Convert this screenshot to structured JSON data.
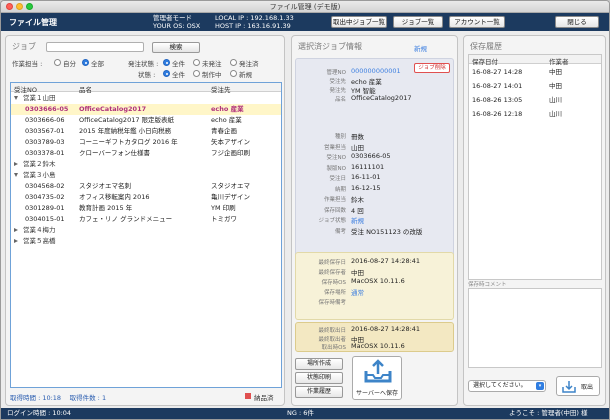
{
  "window": {
    "title": "ファイル管理 (デモ版)"
  },
  "header": {
    "app_title": "ファイル管理",
    "mode_label": "管理者モード",
    "os_label": "YOUR OS: OSX",
    "local_ip": "LOCAL IP : 192.168.1.33",
    "host_ip": "HOST IP : 163.16.91.39",
    "btn_taking": "取出中ジョブ一覧",
    "btn_jobs": "ジョブ一覧",
    "btn_accounts": "アカウント一覧",
    "btn_close": "閉じる"
  },
  "search": {
    "section_title": "ジョブ",
    "search_button": "検索",
    "work_label": "作業担当 :",
    "work_self": "自分",
    "work_all": "全部",
    "dept_label": "発注状態 :",
    "dept_all": "全件",
    "dept_pending": "未発注",
    "dept_ordered": "発注済",
    "status_label": "状態 :",
    "status_all": "全件",
    "status_active": "制作中",
    "status_new": "新規"
  },
  "table": {
    "headers": {
      "no": "受注NO",
      "name": "品名",
      "client": "受注先"
    },
    "groups": [
      {
        "label": "営業１山田",
        "expanded": true,
        "rows": [
          {
            "no": "0303666-05",
            "name": "OfficeCatalog2017",
            "client": "echo 産業",
            "selected": true
          },
          {
            "no": "0303666-06",
            "name": "OfficeCatalog2017 限定版表紙",
            "client": "echo 産業"
          },
          {
            "no": "0303567-01",
            "name": "2015 年度納税年鑑 小日向税務",
            "client": "青春企画"
          },
          {
            "no": "0303789-03",
            "name": "コーニーギフトカタログ 2016 年",
            "client": "矢本アザイン"
          },
          {
            "no": "0303378-01",
            "name": "クローバーフォン仕様書",
            "client": "フジ企画印刷"
          }
        ]
      },
      {
        "label": "営業２鈴木",
        "expanded": false,
        "rows": []
      },
      {
        "label": "営業３小島",
        "expanded": true,
        "rows": [
          {
            "no": "0304568-02",
            "name": "スタジオエマ名刺",
            "client": "スタジオエマ"
          },
          {
            "no": "0304735-02",
            "name": "オフィス移転案内 2016",
            "client": "亀川デザイン"
          },
          {
            "no": "0301289-01",
            "name": "教育計画 2015 年",
            "client": "YM 印刷"
          },
          {
            "no": "0304015-01",
            "name": "カフェ・リノ グランドメニュー",
            "client": "トミガワ"
          }
        ]
      },
      {
        "label": "営業４梅力",
        "expanded": false,
        "rows": []
      },
      {
        "label": "営業５高橋",
        "expanded": false,
        "rows": []
      }
    ],
    "footer": "取得時間 : 10:18 　取得件数 : 1",
    "legend": "納品済"
  },
  "job_info": {
    "section_title": "選択済ジョブ情報",
    "new_link": "新規",
    "delete_button": "ジョブ削除",
    "fields_top": [
      {
        "k": "管理NO",
        "v": "000000000001",
        "blue": true
      },
      {
        "k": "受注先",
        "v": "echo 産業"
      },
      {
        "k": "発注先",
        "v": "YM 智能"
      },
      {
        "k": "品名",
        "v": "OfficeCatalog2017"
      }
    ],
    "fields_bottom": [
      {
        "k": "種別",
        "v": "冊数"
      },
      {
        "k": "営業担当",
        "v": "山田"
      },
      {
        "k": "受注NO",
        "v": "0303666-05"
      },
      {
        "k": "製版NO",
        "v": "16111101"
      },
      {
        "k": "受注日",
        "v": "16-11-01"
      },
      {
        "k": "納期",
        "v": "16-12-15"
      },
      {
        "k": "作業担当",
        "v": "鈴木"
      },
      {
        "k": "保存回数",
        "v": "4 回"
      },
      {
        "k": "ジョブ状態",
        "v": "新規",
        "blue": true
      },
      {
        "k": "備考",
        "v": "受注 NO151123 の改版"
      }
    ]
  },
  "save_info": {
    "fields": [
      {
        "k": "最終保存日",
        "v": "2016-08-27 14:28:41"
      },
      {
        "k": "最終保存者",
        "v": "中田"
      },
      {
        "k": "保存時OS",
        "v": "MacOSX 10.11.6"
      },
      {
        "k": "保存場所",
        "v": "通常",
        "blue": true
      },
      {
        "k": "保存時備考",
        "v": ""
      }
    ]
  },
  "take_info": {
    "fields": [
      {
        "k": "最終取出日",
        "v": "2016-08-27 14:28:41"
      },
      {
        "k": "最終取出者",
        "v": "中田"
      },
      {
        "k": "取出時OS",
        "v": "MacOSX 10.11.6"
      }
    ]
  },
  "actions": {
    "btn_folder": "場所作成",
    "btn_print": "状態印刷",
    "btn_history": "作業履歴",
    "btn_save": "サーバーへ保存"
  },
  "history": {
    "section_title": "保存履歴",
    "headers": {
      "date": "保存日付",
      "user": "作業者"
    },
    "rows": [
      {
        "date": "16-08-27 14:28",
        "user": "中田"
      },
      {
        "date": "16-08-27 14:01",
        "user": "中田"
      },
      {
        "date": "16-08-26 13:05",
        "user": "山川"
      },
      {
        "date": "16-08-26 12:18",
        "user": "山川"
      }
    ],
    "comment_label": "保存時コメント",
    "select_placeholder": "選択してください。",
    "takeout_button": "取出"
  },
  "status": {
    "login_time": "ログイン時間 : 10:04",
    "ng": "NG : 6件",
    "welcome": "ようこそ : 管理者(中田) 様"
  },
  "colors": {
    "accent": "#1c3a5f",
    "selected_text": "#b0307a",
    "link": "#3d7fe0"
  }
}
